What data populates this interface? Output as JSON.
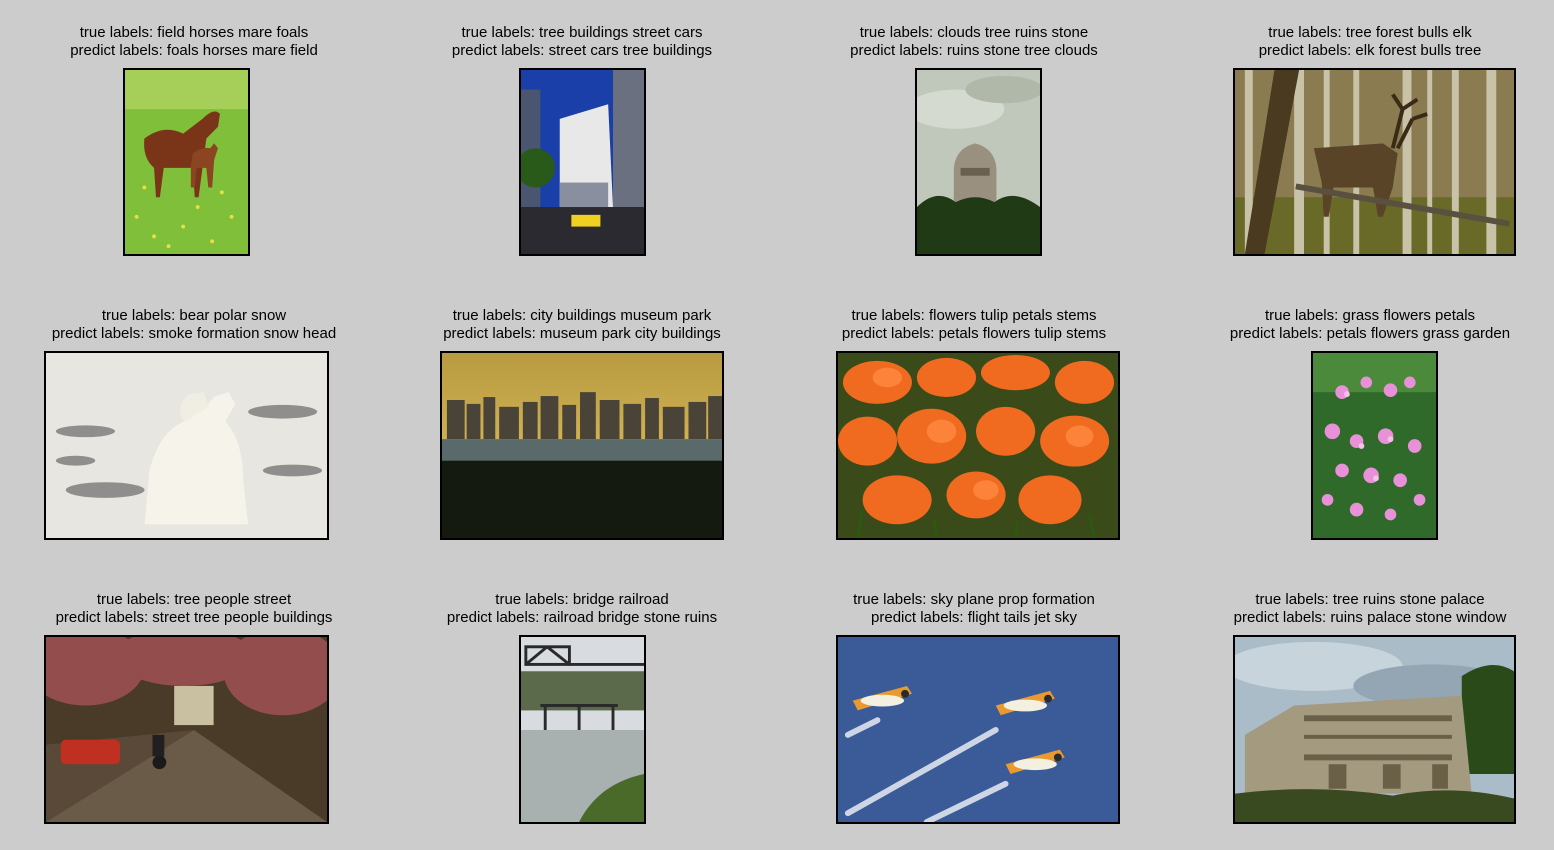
{
  "figure": {
    "items": [
      {
        "true": "true labels: field horses mare foals",
        "pred": "predict labels: foals horses mare field",
        "scene": "horses-photo"
      },
      {
        "true": "true labels: tree buildings street cars",
        "pred": "predict labels: street cars tree buildings",
        "scene": "city-street-photo"
      },
      {
        "true": "true labels: clouds tree ruins stone",
        "pred": "predict labels: ruins stone tree clouds",
        "scene": "ruins-tower-photo"
      },
      {
        "true": "true labels: tree forest bulls elk",
        "pred": "predict labels: elk forest bulls tree",
        "scene": "elk-forest-photo"
      },
      {
        "true": "true labels: bear polar snow",
        "pred": "predict labels: smoke formation snow head",
        "scene": "polar-bears-photo"
      },
      {
        "true": "true labels: city buildings museum park",
        "pred": "predict labels: museum park city buildings",
        "scene": "city-skyline-photo"
      },
      {
        "true": "true labels: flowers tulip petals stems",
        "pred": "predict labels: petals flowers tulip stems",
        "scene": "tulips-photo"
      },
      {
        "true": "true labels: grass flowers petals",
        "pred": "predict labels: petals flowers grass garden",
        "scene": "pink-flowers-photo"
      },
      {
        "true": "true labels: tree people street",
        "pred": "predict labels: street tree people buildings",
        "scene": "tree-street-photo"
      },
      {
        "true": "true labels: bridge railroad",
        "pred": "predict labels: railroad bridge stone ruins",
        "scene": "railroad-bridge-photo"
      },
      {
        "true": "true labels: sky plane prop formation",
        "pred": "predict labels: flight tails jet sky",
        "scene": "plane-formation-photo"
      },
      {
        "true": "true labels: tree ruins stone palace",
        "pred": "predict labels: ruins palace stone window",
        "scene": "palace-ruins-photo"
      }
    ]
  }
}
